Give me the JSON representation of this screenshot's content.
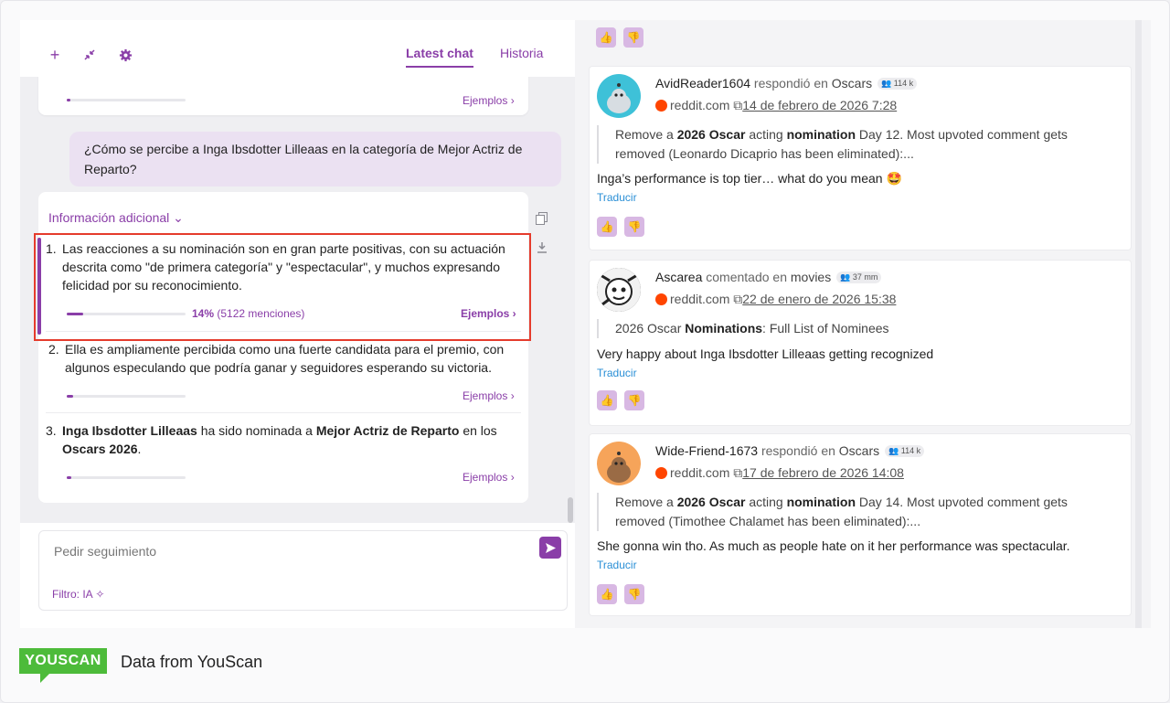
{
  "toolbar": {
    "tabs": [
      {
        "label": "Latest chat",
        "active": true
      },
      {
        "label": "Historia",
        "active": false
      }
    ]
  },
  "chat": {
    "prev_card": {
      "ejemplos": "Ejemplos ›",
      "share": 0.03
    },
    "user_question": "¿Cómo se percibe a Inga Ibsdotter Lilleaas en la categoría de Mejor Actriz de Reparto?",
    "info_header": "Información adicional ⌄",
    "items": [
      {
        "num": "1.",
        "line1": "Las reacciones a su nominación son en gran parte positivas, con su actuación",
        "line2": "descrita como \"de primera categoría\" y \"espectacular\", y muchos expresando",
        "line3": "felicidad por su reconocimiento.",
        "pct_value": "14%",
        "pct_mentions": "(5122 menciones)",
        "ejemplos": "Ejemplos ›",
        "share": 0.14
      },
      {
        "num": "2.",
        "line1": "Ella es ampliamente percibida como una fuerte candidata para el premio, con",
        "line2": "algunos especulando que podría ganar y seguidores esperando su victoria.",
        "ejemplos": "Ejemplos ›",
        "share": 0.05
      },
      {
        "num": "3.",
        "bold1": "Inga Ibsdotter Lilleaas",
        "mid1": " ha sido nominada a ",
        "bold2": "Mejor Actriz de Reparto",
        "mid2": " en los",
        "bold3": "Oscars 2026",
        "end": ".",
        "ejemplos": "Ejemplos ›",
        "share": 0.04
      }
    ],
    "input_placeholder": "Pedir seguimiento",
    "filter_label": "Filtro: IA"
  },
  "posts": [
    {
      "author": "AvidReader1604",
      "action": " respondió en ",
      "channel": "Oscars",
      "badge": "114 k",
      "source": "reddit.com",
      "date": "14 de febrero de 2026 7:28",
      "quote_pre": "Remove a ",
      "quote_b1": "2026 Oscar",
      "quote_mid": " acting ",
      "quote_b2": "nomination",
      "quote_post1": " Day 12. Most upvoted comment gets",
      "quote_line2": "removed (Leonardo Dicaprio has been eliminated):...",
      "text": "Inga’s performance is top tier… what do you mean 🤩",
      "translate": "Traducir"
    },
    {
      "author": "Ascarea",
      "action": " comentado en ",
      "channel": "movies",
      "badge": "37 mm",
      "source": "reddit.com",
      "date": "22 de enero de 2026 15:38",
      "quote_pre": "2026 Oscar ",
      "quote_b1": "Nominations",
      "quote_post": ": Full List of Nominees",
      "text": "Very happy about Inga Ibsdotter Lilleaas getting recognized",
      "translate": "Traducir"
    },
    {
      "author": "Wide-Friend-1673",
      "action": " respondió en ",
      "channel": "Oscars",
      "badge": "114 k",
      "source": "reddit.com",
      "date": "17 de febrero de 2026 14:08",
      "quote_pre": "Remove a ",
      "quote_b1": "2026 Oscar",
      "quote_mid": " acting ",
      "quote_b2": "nomination",
      "quote_post1": " Day 14. Most upvoted comment gets",
      "quote_line2": "removed (Timothee Chalamet has been eliminated):...",
      "text": "She gonna win tho. As much as people hate on it her performance was spectacular.",
      "translate": "Traducir"
    }
  ],
  "footer": {
    "logo": "YOUSCAN",
    "text": "Data from YouScan"
  },
  "colors": {
    "accent": "#8a3ea8",
    "highlight": "#e53b2c",
    "brand": "#4dbb3a",
    "reddit": "#ff4500",
    "link": "#2a8fd6"
  },
  "icons": [
    "plus-icon",
    "collapse-icon",
    "gear-icon",
    "copy-icon",
    "download-icon",
    "send-icon",
    "sparkle-icon",
    "reddit-icon",
    "external-link-icon",
    "thumbs-up-icon",
    "thumbs-down-icon"
  ]
}
